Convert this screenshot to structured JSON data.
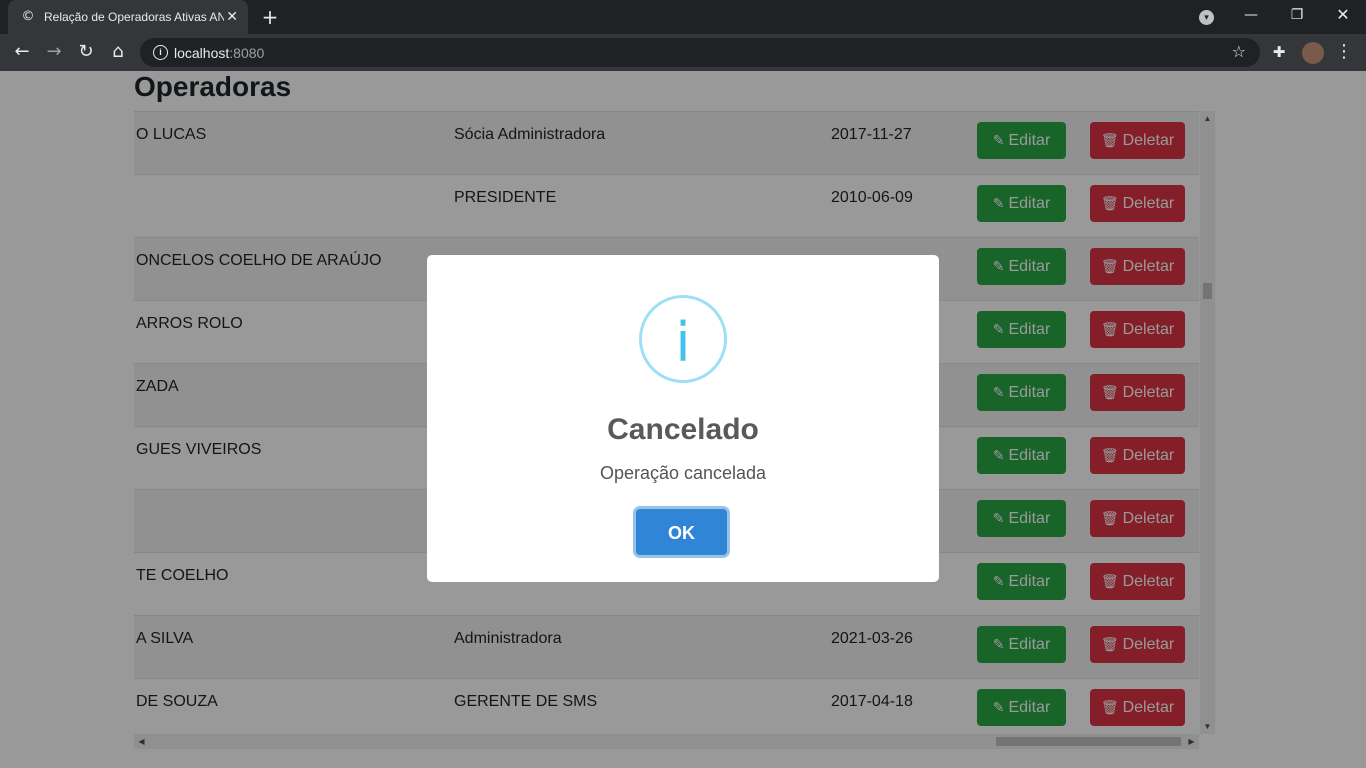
{
  "browser": {
    "tab_title": "Relação de Operadoras Ativas AN",
    "tab_favicon": "c",
    "url_host": "localhost",
    "url_port": ":8080"
  },
  "page": {
    "title": "Operadoras",
    "edit_label": "Editar",
    "delete_label": "Deletar",
    "rows": [
      {
        "name": "O LUCAS",
        "role": "Sócia Administradora",
        "date": "2017-11-27"
      },
      {
        "name": "",
        "role": "PRESIDENTE",
        "date": "2010-06-09"
      },
      {
        "name": "ONCELOS COELHO DE ARAÚJO",
        "role": "",
        "date": ""
      },
      {
        "name": "ARROS ROLO",
        "role": "",
        "date": ""
      },
      {
        "name": "ZADA",
        "role": "",
        "date": ""
      },
      {
        "name": "GUES VIVEIROS",
        "role": "",
        "date": ""
      },
      {
        "name": "",
        "role": "",
        "date": ""
      },
      {
        "name": "TE COELHO",
        "role": "",
        "date": ""
      },
      {
        "name": "A SILVA",
        "role": "Administradora",
        "date": "2021-03-26"
      },
      {
        "name": "DE SOUZA",
        "role": "GERENTE DE SMS",
        "date": "2017-04-18"
      }
    ]
  },
  "modal": {
    "title": "Cancelado",
    "text": "Operação cancelada",
    "ok_label": "OK",
    "icon": "info-icon"
  },
  "colors": {
    "edit": "#28a745",
    "delete": "#dc3545",
    "ok": "#3085d6",
    "info": "#3fc3ee"
  }
}
